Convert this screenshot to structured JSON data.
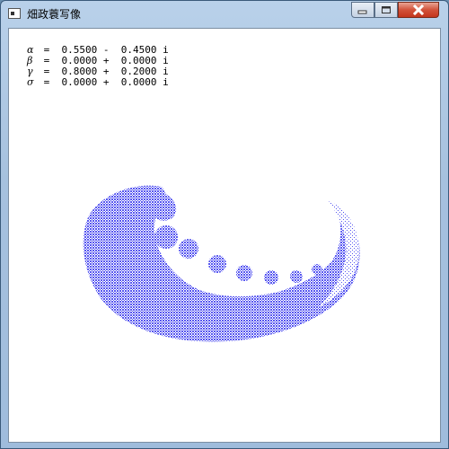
{
  "window": {
    "title": "畑政蓑写像",
    "controls": {
      "minimize": "minimize",
      "maximize": "maximize",
      "close": "close"
    }
  },
  "parameters": [
    {
      "symbol": "α",
      "text": " =  0.5500 -  0.4500 i"
    },
    {
      "symbol": "β",
      "text": " =  0.0000 +  0.0000 i"
    },
    {
      "symbol": "γ",
      "text": " =  0.8000 +  0.2000 i"
    },
    {
      "symbol": "σ",
      "text": " =  0.0000 +  0.0000 i"
    }
  ],
  "plot": {
    "point_color": "#5656f0",
    "background": "#ffffff"
  }
}
